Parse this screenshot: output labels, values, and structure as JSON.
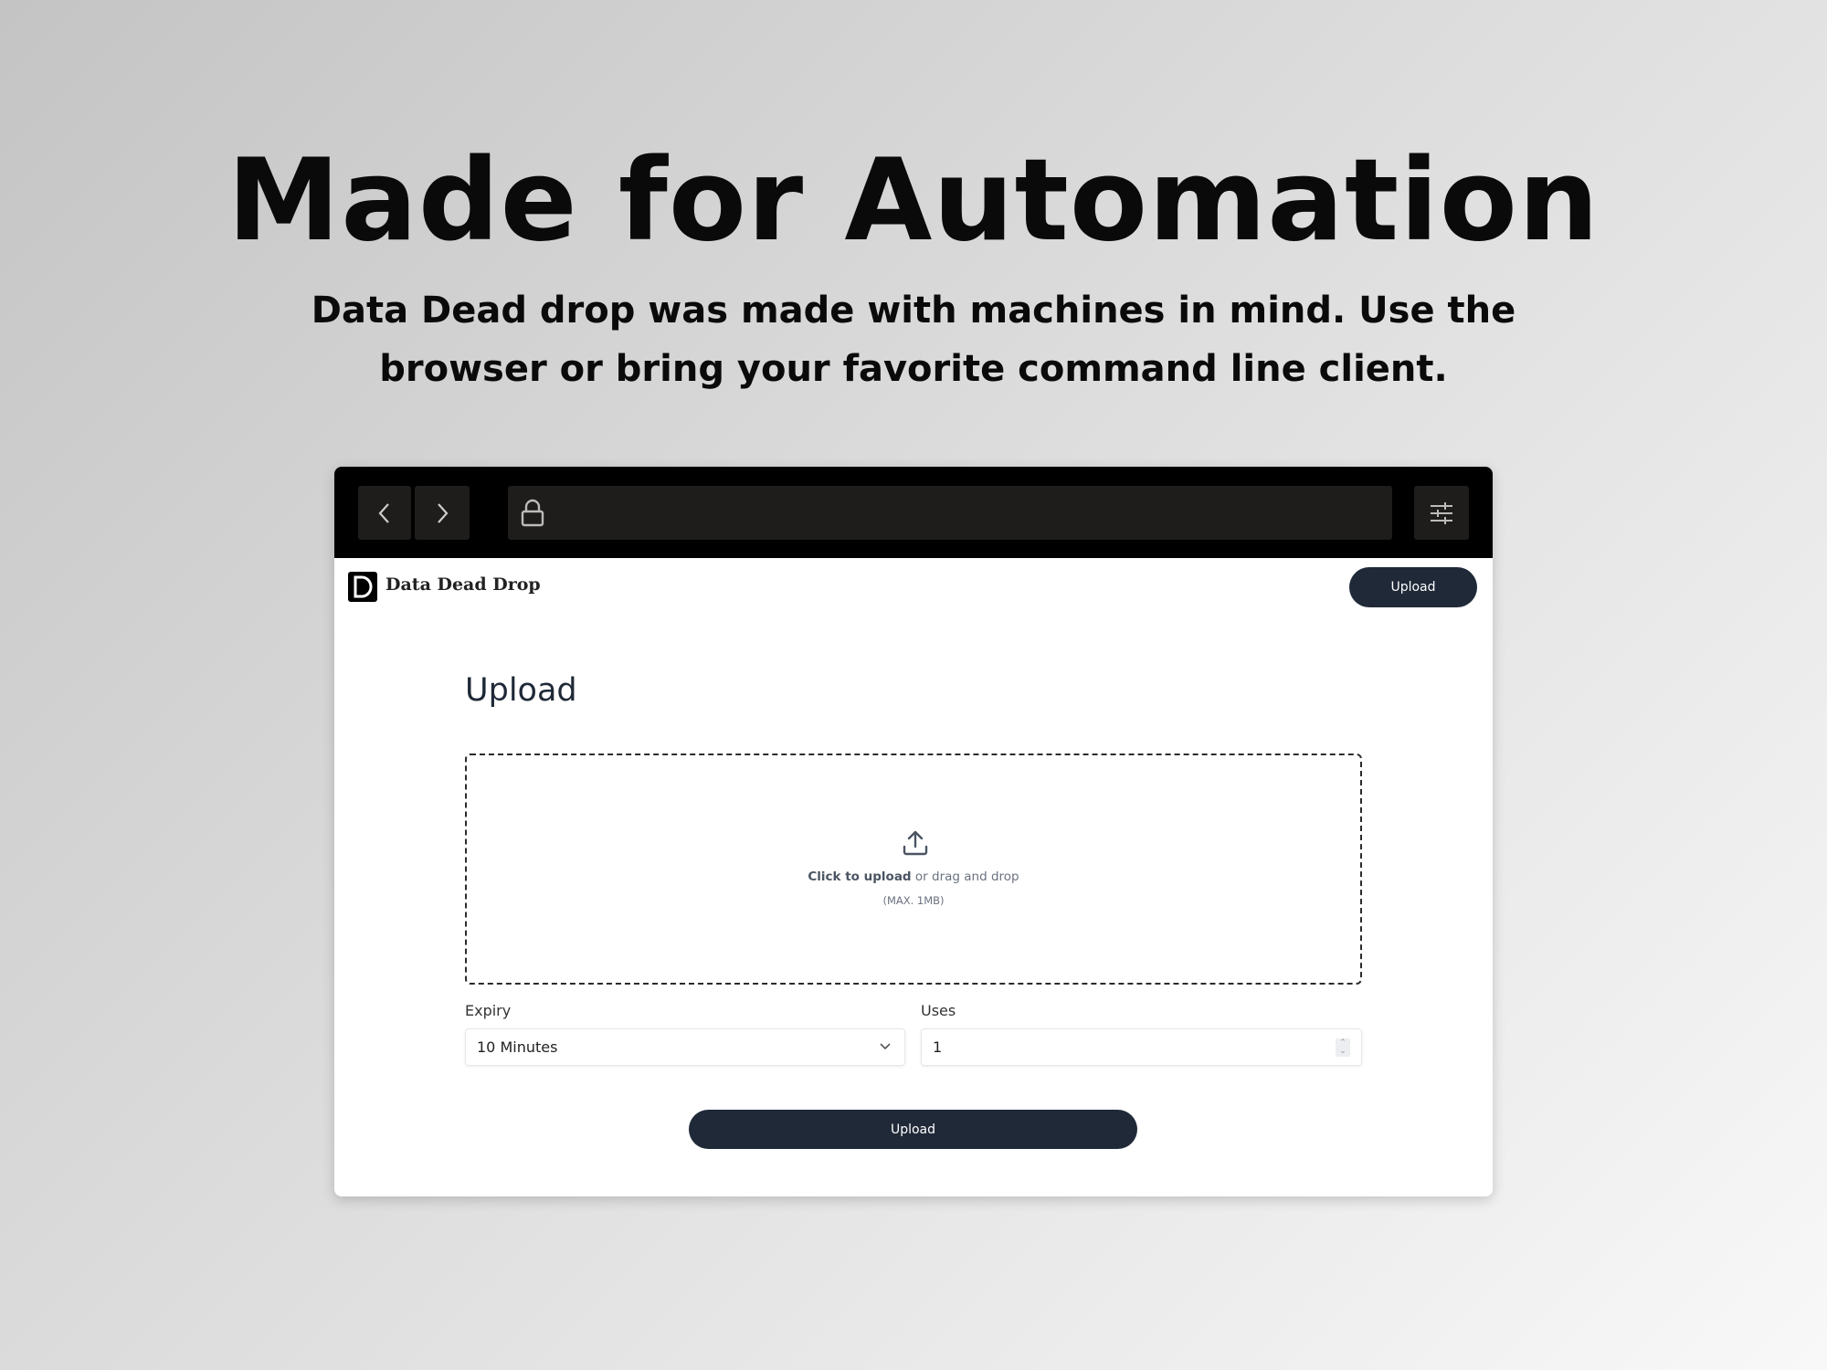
{
  "hero": {
    "title": "Made for Automation",
    "subtitle_line1": "Data Dead drop was made with machines in mind. Use the",
    "subtitle_line2": "browser or bring your favorite command line client."
  },
  "browser": {
    "back_icon": "chevron-left-icon",
    "forward_icon": "chevron-right-icon",
    "lock_icon": "lock-icon",
    "settings_icon": "sliders-icon"
  },
  "app": {
    "brand": "Data Dead Drop",
    "header_button": "Upload",
    "page_title": "Upload",
    "dropzone": {
      "click_text": "Click to upload",
      "rest_text": " or drag and drop",
      "hint": "(MAX. 1MB)"
    },
    "expiry": {
      "label": "Expiry",
      "value": "10 Minutes"
    },
    "uses": {
      "label": "Uses",
      "value": "1"
    },
    "submit_button": "Upload",
    "accent": "#202938"
  }
}
